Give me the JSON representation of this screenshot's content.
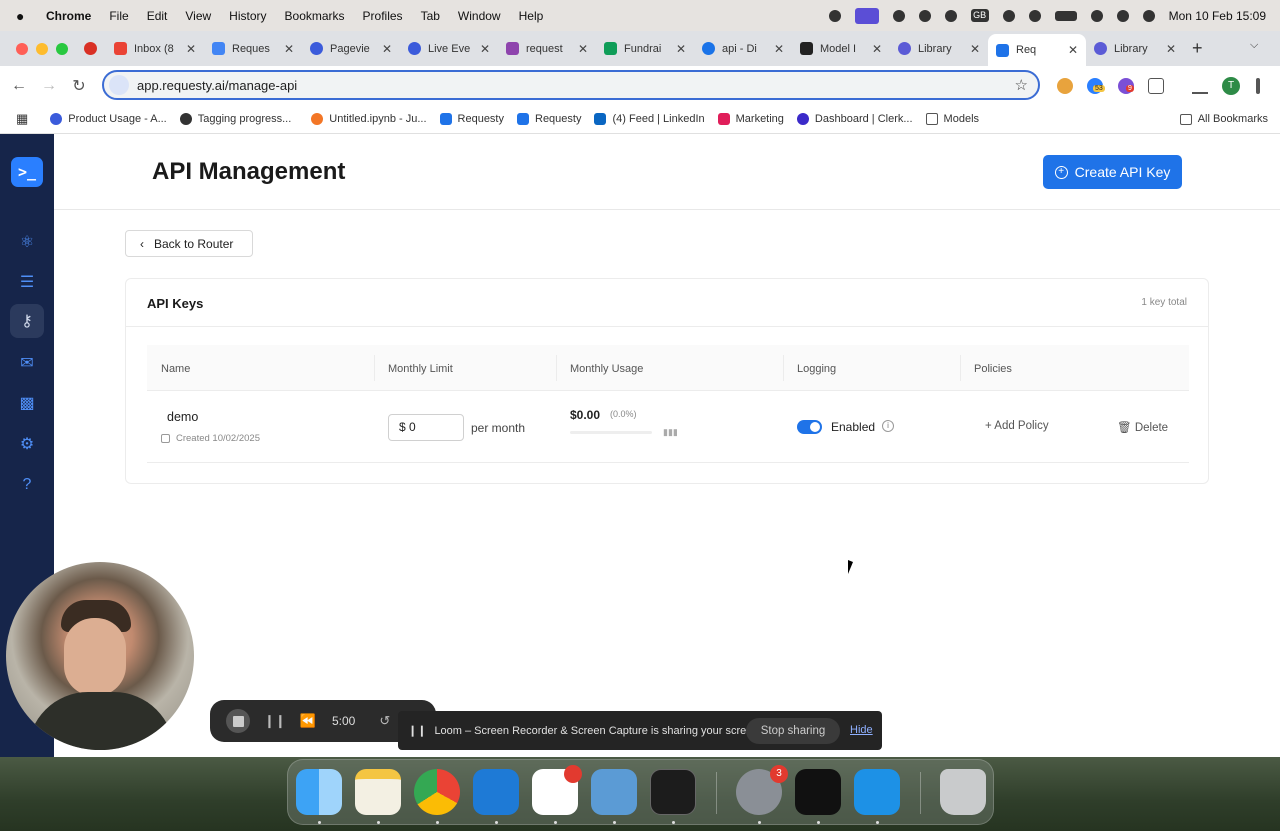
{
  "menubar": {
    "apple": "",
    "app_name": "Chrome",
    "items": [
      "File",
      "Edit",
      "View",
      "History",
      "Bookmarks",
      "Profiles",
      "Tab",
      "Window",
      "Help"
    ],
    "lang": "GB",
    "datetime": "Mon 10 Feb  15:09"
  },
  "tabs": [
    {
      "label": "",
      "color": "#d93025"
    },
    {
      "label": "Inbox (8",
      "color": "#ea4335"
    },
    {
      "label": "Reques",
      "color": "#4285f4"
    },
    {
      "label": "Pagevie",
      "color": "#3b5bdb"
    },
    {
      "label": "Live Eve",
      "color": "#3b5bdb"
    },
    {
      "label": "request",
      "color": "#8e44ad"
    },
    {
      "label": "Fundrai",
      "color": "#0f9d58"
    },
    {
      "label": "api - Di",
      "color": "#1a73e8"
    },
    {
      "label": "Model I",
      "color": "#222222"
    },
    {
      "label": "Library",
      "color": "#5b5bd6"
    },
    {
      "label": "Req",
      "color": "#1f73e8"
    },
    {
      "label": "Library",
      "color": "#5b5bd6"
    }
  ],
  "toolbar": {
    "url": "app.requesty.ai/manage-api",
    "ext_badges": [
      "53",
      "9"
    ],
    "profile_initial": "T"
  },
  "bookmarks": {
    "items": [
      "Product Usage - A...",
      "Tagging progress...",
      "Untitled.ipynb - Ju...",
      "Requesty",
      "Requesty",
      "(4) Feed | LinkedIn",
      "Marketing",
      "Dashboard | Clerk...",
      "Models"
    ],
    "all_label": "All Bookmarks"
  },
  "app": {
    "logo_text": ">_",
    "page_title": "API Management",
    "create_button": "Create API Key",
    "back_button": "Back to Router",
    "card_title": "API Keys",
    "key_count": "1 key total",
    "columns": [
      "Name",
      "Monthly Limit",
      "Monthly Usage",
      "Logging",
      "Policies"
    ],
    "rows": [
      {
        "name": "demo",
        "created": "Created 10/02/2025",
        "limit": "$ 0",
        "limit_unit": "per month",
        "usage": "$0.00",
        "usage_pct": "(0.0%)",
        "usage_fraction": 0,
        "logging_enabled": true,
        "logging_label": "Enabled",
        "add_policy": "+ Add Policy",
        "delete": "Delete"
      }
    ]
  },
  "recorder": {
    "time": "5:00"
  },
  "loom": {
    "message": "Loom – Screen Recorder & Screen Capture is sharing your screen.",
    "stop": "Stop sharing",
    "hide": "Hide"
  },
  "dock": {
    "badges": [
      "",
      "3"
    ]
  },
  "colors": {
    "accent": "#1f73e8",
    "sidebar": "#16254a"
  }
}
